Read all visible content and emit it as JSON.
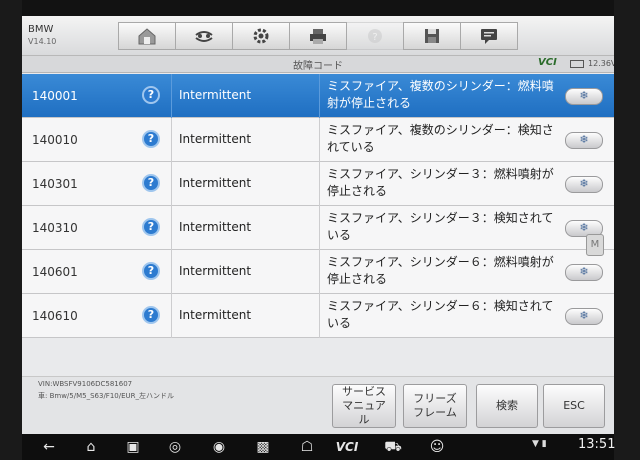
{
  "app": {
    "name": "BMW",
    "version": "V14.10"
  },
  "toolbar": {
    "icons": [
      "home-icon",
      "vehicle-swap-icon",
      "settings-icon",
      "print-icon",
      "help-icon",
      "save-icon",
      "message-icon"
    ]
  },
  "subbar": {
    "title": "故障コード",
    "vci": "VCI",
    "voltage": "12.36V"
  },
  "codes": [
    {
      "code": "140001",
      "status": "Intermittent",
      "description": "ミスファイア、複数のシリンダー：燃料噴射が停止される",
      "selected": true
    },
    {
      "code": "140010",
      "status": "Intermittent",
      "description": "ミスファイア、複数のシリンダー：検知されている",
      "selected": false
    },
    {
      "code": "140301",
      "status": "Intermittent",
      "description": "ミスファイア、シリンダー３：燃料噴射が停止される",
      "selected": false
    },
    {
      "code": "140310",
      "status": "Intermittent",
      "description": "ミスファイア、シリンダー３：検知されている",
      "selected": false
    },
    {
      "code": "140601",
      "status": "Intermittent",
      "description": "ミスファイア、シリンダー６：燃料噴射が停止される",
      "selected": false
    },
    {
      "code": "140610",
      "status": "Intermittent",
      "description": "ミスファイア、シリンダー６：検知されている",
      "selected": false
    }
  ],
  "help_glyph": "?",
  "freeze_glyph": "❄",
  "footer": {
    "vin": "VIN:WBSFV9106DC581607",
    "vehicle": "車: Bmw/5/M5_S63/F10/EUR_左ハンドル",
    "buttons": {
      "service_manual": "サービスマニュアル",
      "freeze_frame": "フリーズフレーム",
      "search": "検索",
      "esc": "ESC"
    }
  },
  "side_tab": "M",
  "navbar": {
    "icons": [
      "back-icon",
      "home-icon",
      "browser-icon",
      "camera-icon",
      "screenshot-icon",
      "autel-home-icon",
      "vci-icon",
      "car-icon",
      "users-icon"
    ],
    "vci_label": "VCI",
    "time": "13:51"
  },
  "colors": {
    "selected_row": "#2a7ccc",
    "accent": "#2d7bd0"
  }
}
